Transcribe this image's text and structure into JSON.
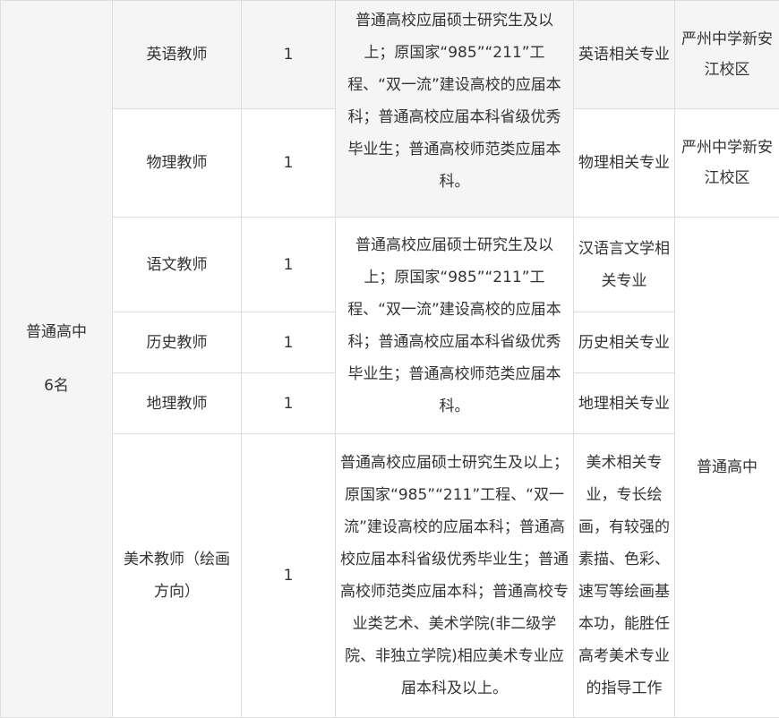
{
  "category": {
    "label": "普通高中",
    "count": "6名"
  },
  "rows": [
    {
      "position": "英语教师",
      "number": "1",
      "major": "英语相关专业",
      "location": "严州中学新安江校区"
    },
    {
      "position": "物理教师",
      "number": "1",
      "major": "物理相关专业",
      "location": "严州中学新安江校区"
    },
    {
      "position": "语文教师",
      "number": "1",
      "major": "汉语言文学相关专业"
    },
    {
      "position": "历史教师",
      "number": "1",
      "major": "历史相关专业"
    },
    {
      "position": "地理教师",
      "number": "1",
      "major": "地理相关专业"
    },
    {
      "position": "美术教师（绘画方向）",
      "number": "1",
      "major": "美术相关专业，专长绘画，有较强的素描、色彩、速写等绘画基本功，能胜任高考美术专业的指导工作"
    }
  ],
  "requirements": {
    "group1": "普通高校应届硕士研究生及以上；原国家“985”“211”工程、“双一流”建设高校的应届本科；普通高校应届本科省级优秀毕业生；普通高校师范类应届本科。",
    "group2": "普通高校应届硕士研究生及以上；原国家“985”“211”工程、“双一流”建设高校的应届本科；普通高校应届本科省级优秀毕业生；普通高校师范类应届本科。",
    "group3": "普通高校应届硕士研究生及以上；原国家“985”“211”工程、“双一流”建设高校的应届本科；普通高校应届本科省级优秀毕业生；普通高校师范类应届本科；普通高校专业类艺术、美术学院(非二级学院、非独立学院)相应美术专业应届本科及以上。"
  },
  "location_shared": "普通高中",
  "colors": {
    "border": "#dddddd",
    "shade": "#f5f5f5",
    "text": "#333333"
  }
}
